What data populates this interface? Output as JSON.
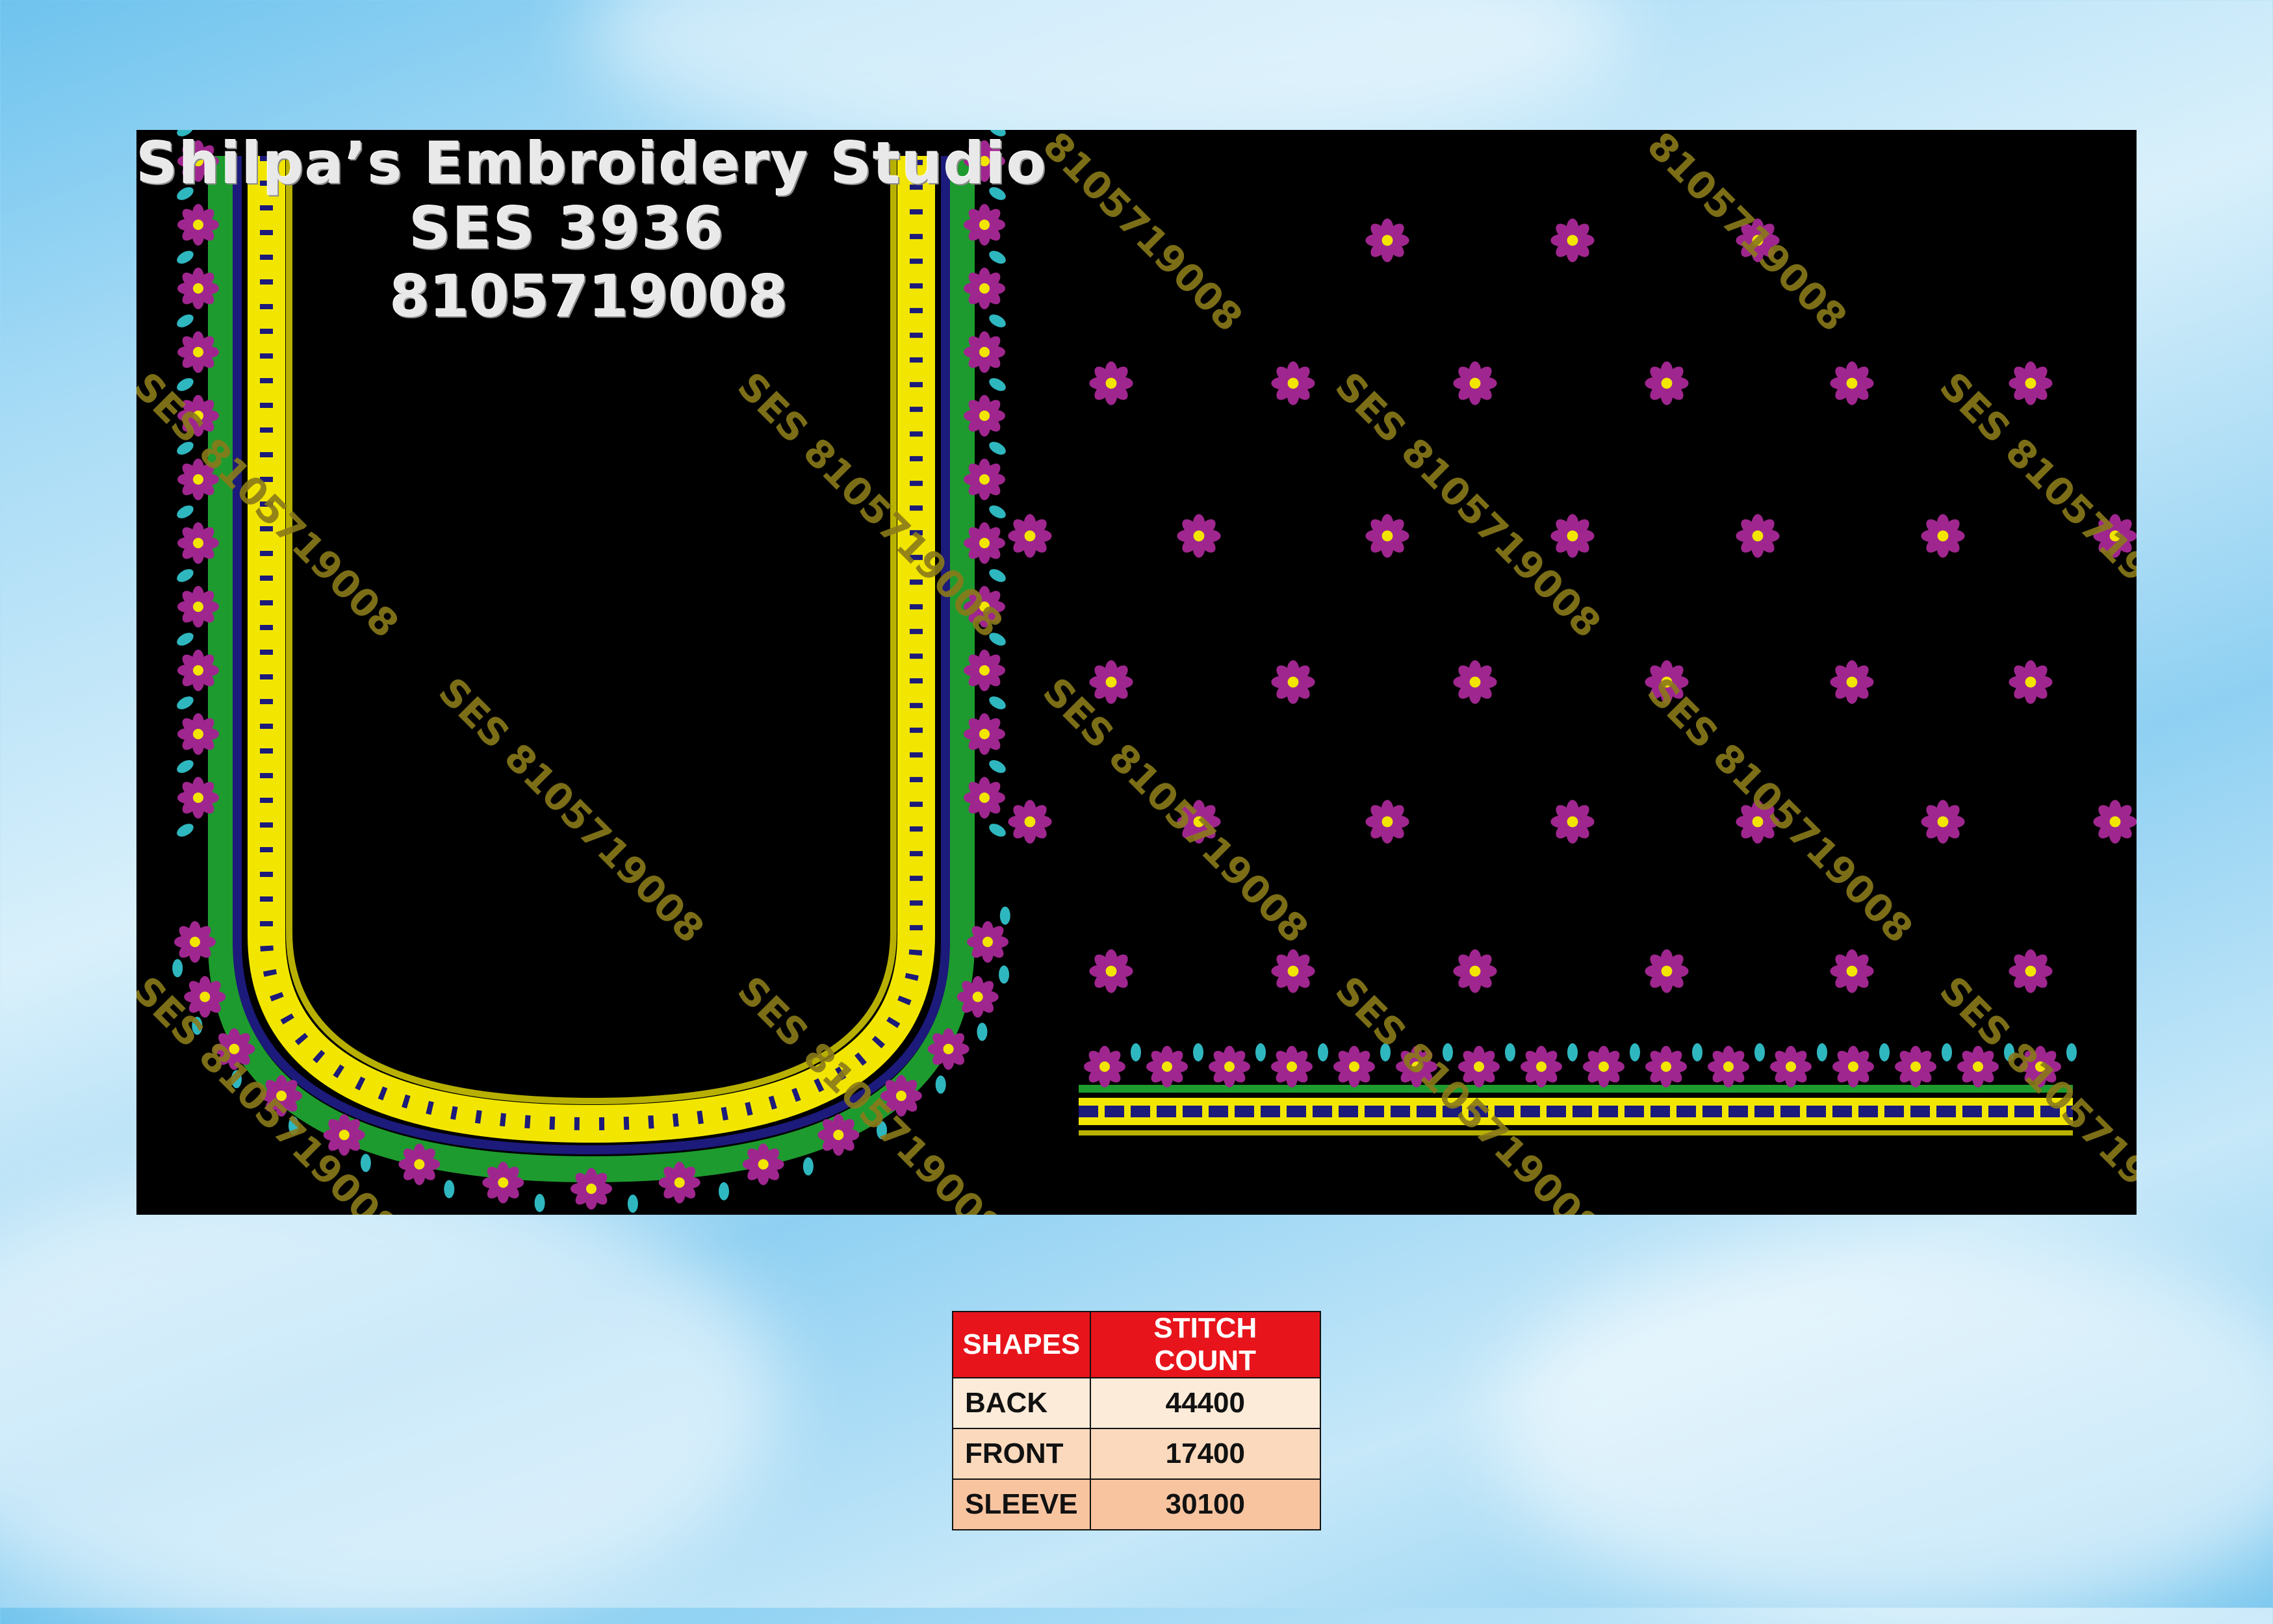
{
  "header": {
    "studio_name": "Shilpa’s Embroidery Studio",
    "design_code": "SES 3936",
    "phone": "8105719008"
  },
  "watermark": {
    "text": "SES 8105719008",
    "short_text": "8105719008"
  },
  "colors": {
    "flower_petal": "#a0268f",
    "flower_center": "#f2e600",
    "leaf_green": "#1e9b2e",
    "teal_drop": "#2fb7c0",
    "border_yellow": "#f2e600",
    "border_navy": "#1c1a7a",
    "table_header": "#e8141b"
  },
  "table": {
    "headers": [
      "SHAPES",
      "STITCH COUNT"
    ],
    "rows": [
      {
        "shape": "BACK",
        "count": "44400"
      },
      {
        "shape": "FRONT",
        "count": "17400"
      },
      {
        "shape": "SLEEVE",
        "count": "30100"
      }
    ]
  }
}
